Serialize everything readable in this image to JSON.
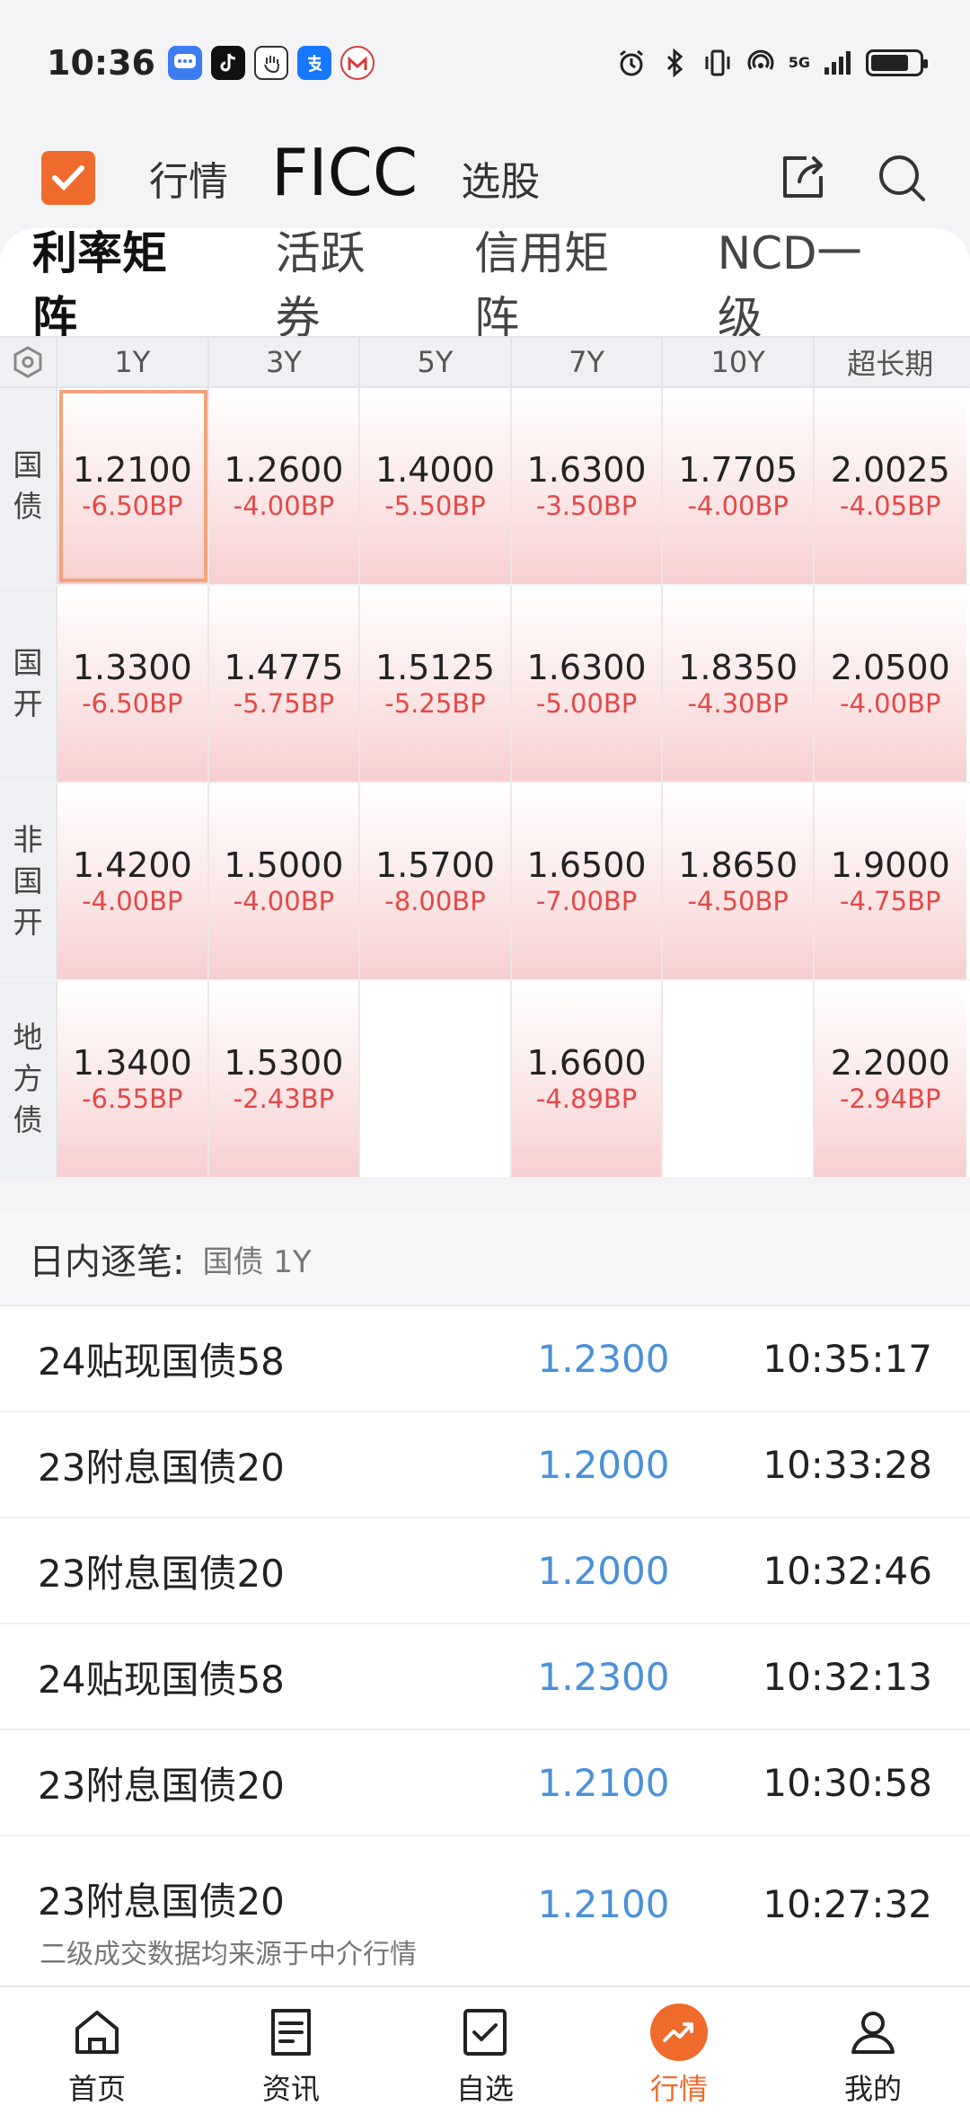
{
  "status_bar": {
    "time": "10:36",
    "network": "5G"
  },
  "header": {
    "tabs": [
      "行情",
      "FICC",
      "选股"
    ],
    "active_tab": "FICC",
    "accent_color": "#f06a2c"
  },
  "subtabs": [
    "利率矩阵",
    "活跃券",
    "信用矩阵",
    "NCD一级"
  ],
  "matrix": {
    "columns": [
      "1Y",
      "3Y",
      "5Y",
      "7Y",
      "10Y",
      "超长期"
    ],
    "rows": [
      {
        "label": [
          "国",
          "债"
        ],
        "cells": [
          {
            "value": "1.2100",
            "bp": "-6.50BP"
          },
          {
            "value": "1.2600",
            "bp": "-4.00BP"
          },
          {
            "value": "1.4000",
            "bp": "-5.50BP"
          },
          {
            "value": "1.6300",
            "bp": "-3.50BP"
          },
          {
            "value": "1.7705",
            "bp": "-4.00BP"
          },
          {
            "value": "2.0025",
            "bp": "-4.05BP"
          }
        ]
      },
      {
        "label": [
          "国",
          "开"
        ],
        "cells": [
          {
            "value": "1.3300",
            "bp": "-6.50BP"
          },
          {
            "value": "1.4775",
            "bp": "-5.75BP"
          },
          {
            "value": "1.5125",
            "bp": "-5.25BP"
          },
          {
            "value": "1.6300",
            "bp": "-5.00BP"
          },
          {
            "value": "1.8350",
            "bp": "-4.30BP"
          },
          {
            "value": "2.0500",
            "bp": "-4.00BP"
          }
        ]
      },
      {
        "label": [
          "非",
          "国",
          "开"
        ],
        "cells": [
          {
            "value": "1.4200",
            "bp": "-4.00BP"
          },
          {
            "value": "1.5000",
            "bp": "-4.00BP"
          },
          {
            "value": "1.5700",
            "bp": "-8.00BP"
          },
          {
            "value": "1.6500",
            "bp": "-7.00BP"
          },
          {
            "value": "1.8650",
            "bp": "-4.50BP"
          },
          {
            "value": "1.9000",
            "bp": "-4.75BP"
          }
        ]
      },
      {
        "label": [
          "地",
          "方",
          "债"
        ],
        "cells": [
          {
            "value": "1.3400",
            "bp": "-6.55BP"
          },
          {
            "value": "1.5300",
            "bp": "-2.43BP"
          },
          null,
          {
            "value": "1.6600",
            "bp": "-4.89BP"
          },
          null,
          {
            "value": "2.2000",
            "bp": "-2.94BP"
          }
        ]
      }
    ]
  },
  "intraday": {
    "title": "日内逐笔:",
    "selection": "国债 1Y",
    "trades": [
      {
        "name": "24贴现国债58",
        "price": "1.2300",
        "time": "10:35:17"
      },
      {
        "name": "23附息国债20",
        "price": "1.2000",
        "time": "10:33:28"
      },
      {
        "name": "23附息国债20",
        "price": "1.2000",
        "time": "10:32:46"
      },
      {
        "name": "24贴现国债58",
        "price": "1.2300",
        "time": "10:32:13"
      },
      {
        "name": "23附息国债20",
        "price": "1.2100",
        "time": "10:30:58"
      },
      {
        "name": "23附息国债20",
        "price": "1.2100",
        "time": "10:27:32"
      }
    ],
    "footnote": "二级成交数据均来源于中介行情"
  },
  "bottom_nav": [
    {
      "label": "首页",
      "icon": "home-icon"
    },
    {
      "label": "资讯",
      "icon": "news-icon"
    },
    {
      "label": "自选",
      "icon": "checkbox-icon"
    },
    {
      "label": "行情",
      "icon": "trend-icon",
      "active": true
    },
    {
      "label": "我的",
      "icon": "profile-icon"
    }
  ]
}
